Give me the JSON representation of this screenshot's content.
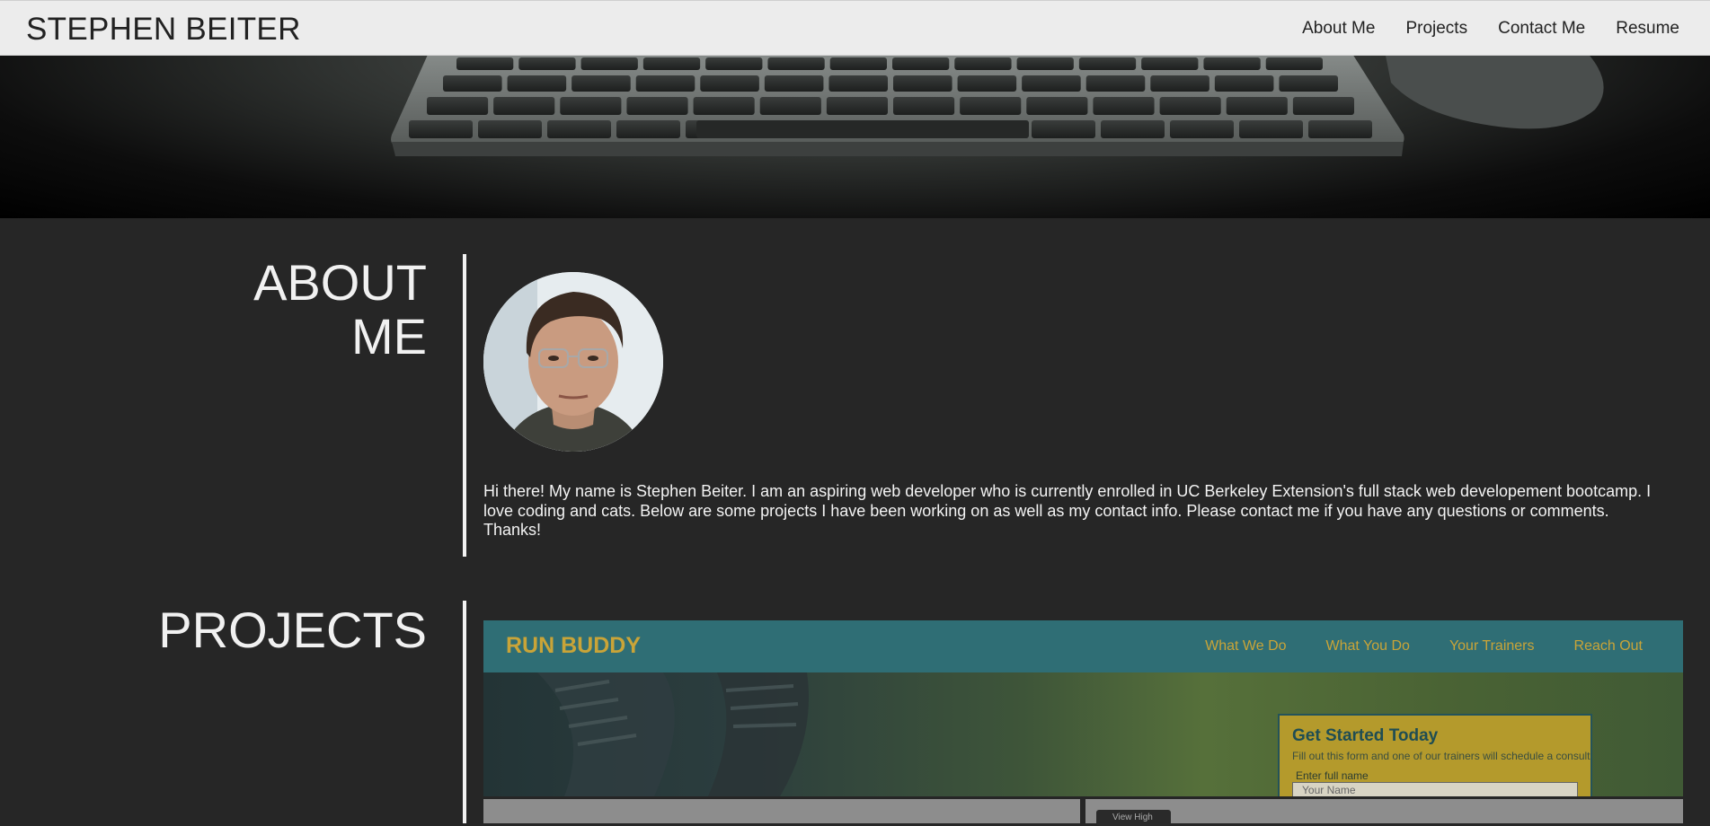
{
  "header": {
    "brand": "STEPHEN BEITER",
    "nav": [
      "About Me",
      "Projects",
      "Contact Me",
      "Resume"
    ]
  },
  "about": {
    "title_line1": "ABOUT",
    "title_line2": "ME",
    "text": "Hi there! My name is Stephen Beiter. I am an aspiring web developer who is currently enrolled in UC Berkeley Extension's full stack web developement bootcamp. I love coding and cats. Below are some projects I have been working on as well as my contact info. Please contact me if you have any questions or comments. Thanks!"
  },
  "projects": {
    "title": "PROJECTS",
    "run_buddy": {
      "brand": "RUN BUDDY",
      "nav": [
        "What We Do",
        "What You Do",
        "Your Trainers",
        "Reach Out"
      ],
      "card_title": "Get Started Today",
      "card_subtitle": "Fill out this form and one of our trainers will schedule a consult",
      "field_label": "Enter full name",
      "field_placeholder": "Your Name"
    },
    "thumb_button": "View High"
  },
  "colors": {
    "header_bg": "#ececec",
    "page_bg": "#262626",
    "accent_gold": "#c9a438",
    "run_buddy_teal": "#2f6e75"
  }
}
